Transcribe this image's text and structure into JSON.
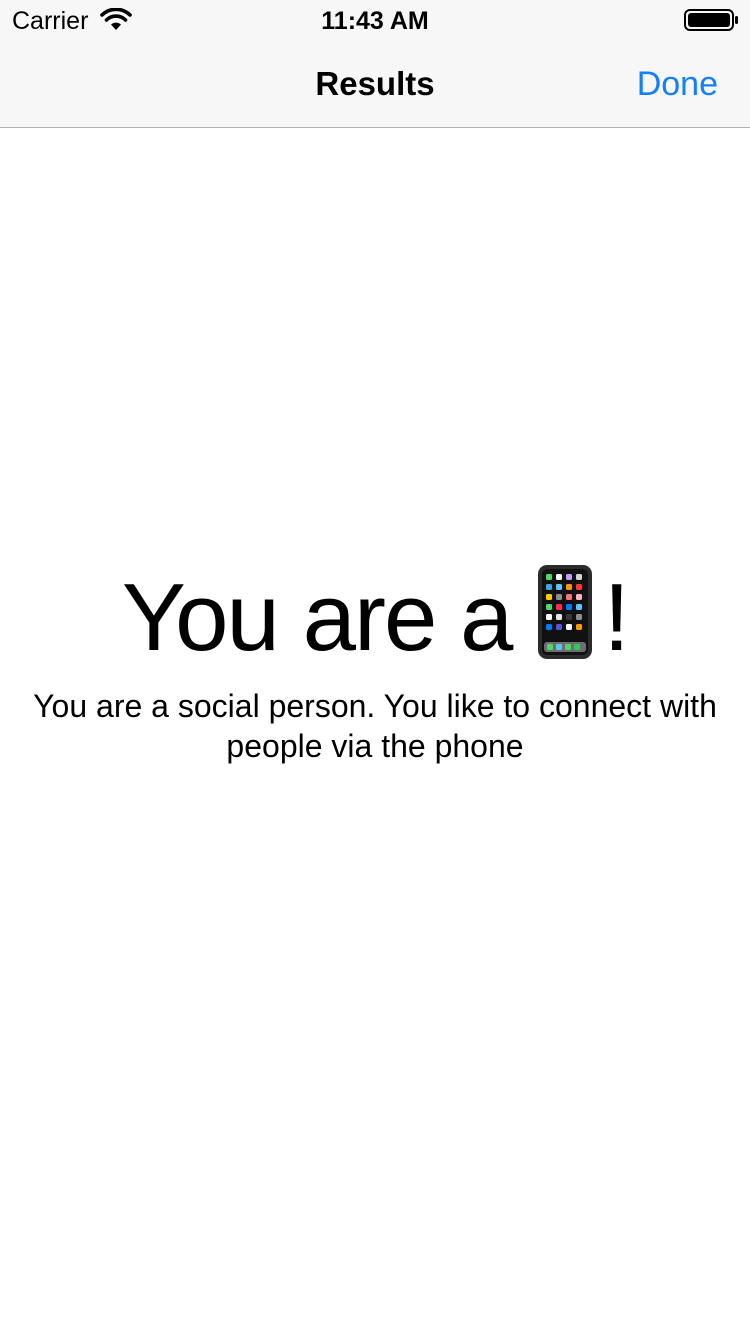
{
  "status_bar": {
    "carrier": "Carrier",
    "time": "11:43 AM",
    "wifi_icon": "wifi-icon",
    "battery_icon": "battery-full-icon"
  },
  "nav_bar": {
    "title": "Results",
    "done_label": "Done",
    "accent_color": "#147efb"
  },
  "result": {
    "heading_prefix": "You are a",
    "emoji_icon": "mobile-phone-emoji",
    "heading_suffix": "!",
    "description": "You are a social person. You like to connect with people via the phone"
  }
}
